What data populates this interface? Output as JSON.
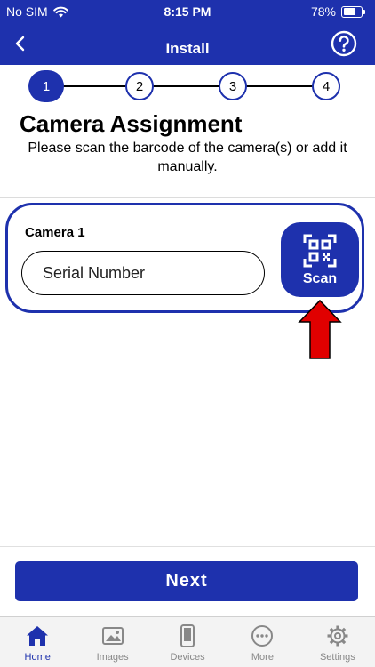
{
  "status_bar": {
    "carrier": "No SIM",
    "time": "8:15 PM",
    "battery": "78%",
    "battery_level": 0.78
  },
  "header": {
    "title": "Install"
  },
  "stepper": {
    "steps": [
      "1",
      "2",
      "3",
      "4"
    ],
    "current": 1
  },
  "page": {
    "title": "Camera Assignment",
    "subtitle": "Please scan the barcode of the camera(s) or add it manually."
  },
  "camera_card": {
    "label": "Camera 1",
    "serial_value": "",
    "serial_placeholder": "Serial Number",
    "scan_label": "Scan"
  },
  "next_label": "Next",
  "tabs": [
    {
      "label": "Home",
      "icon": "home-icon",
      "active": true
    },
    {
      "label": "Images",
      "icon": "images-icon",
      "active": false
    },
    {
      "label": "Devices",
      "icon": "devices-icon",
      "active": false
    },
    {
      "label": "More",
      "icon": "more-icon",
      "active": false
    },
    {
      "label": "Settings",
      "icon": "settings-icon",
      "active": false
    }
  ],
  "colors": {
    "brand": "#1E31AD",
    "arrow": "#E00000",
    "tab_inactive": "#888888"
  }
}
